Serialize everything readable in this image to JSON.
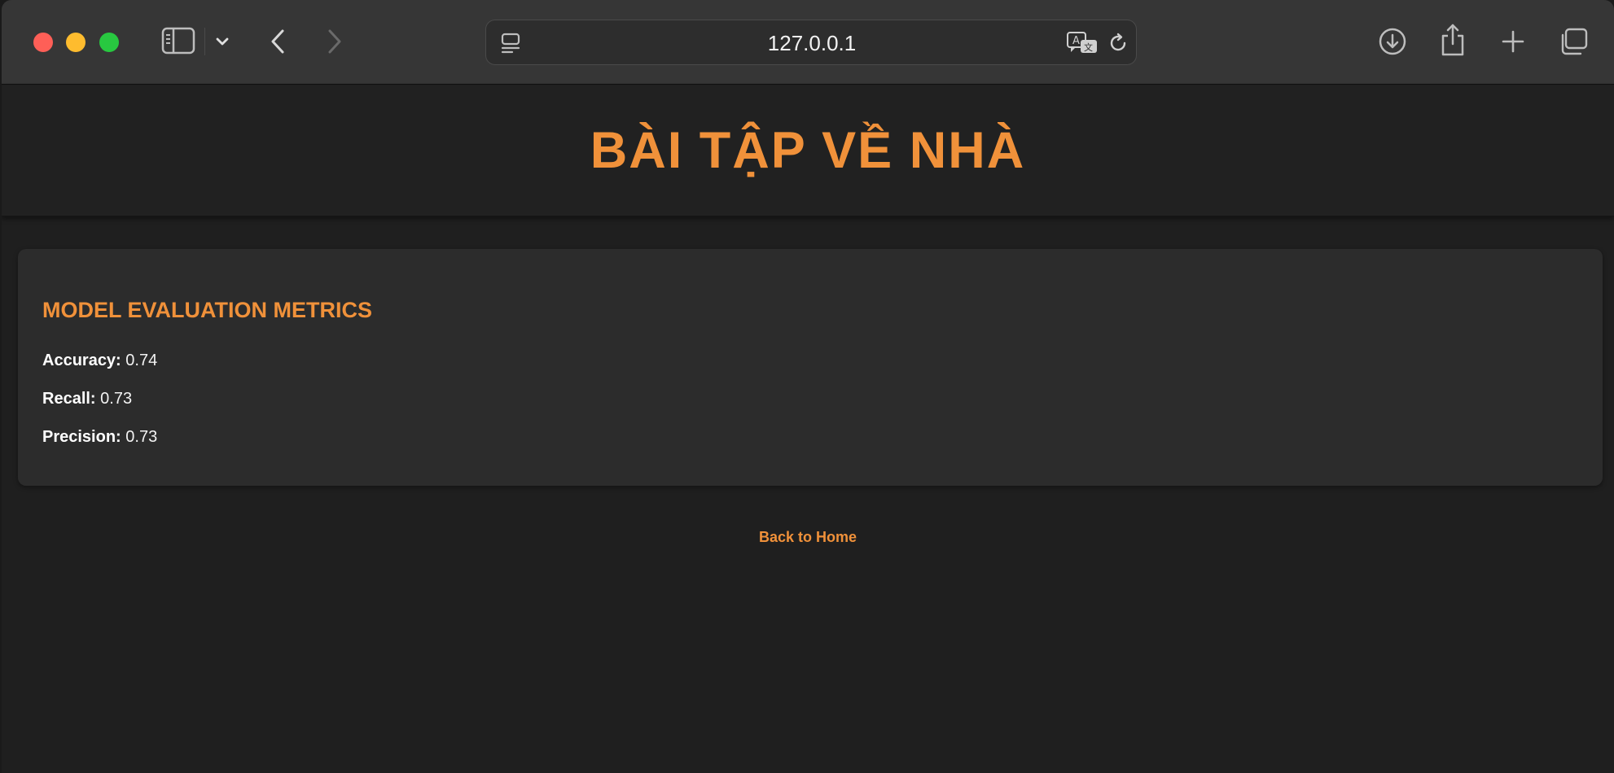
{
  "browser": {
    "url": "127.0.0.1",
    "icons": {
      "sidebar": "sidebar-icon",
      "chevron": "chevron-down-icon",
      "back": "back-arrow-icon",
      "forward": "forward-arrow-icon",
      "reader": "reader-icon",
      "translate": "translate-icon",
      "reload": "reload-icon",
      "download": "download-icon",
      "share": "share-icon",
      "new_tab": "plus-icon",
      "tabs": "tab-overview-icon"
    }
  },
  "page": {
    "title": "BÀI TẬP VỀ NHÀ",
    "metrics_card": {
      "heading": "MODEL EVALUATION METRICS",
      "items": [
        {
          "label": "Accuracy:",
          "value": "0.74"
        },
        {
          "label": "Recall:",
          "value": "0.73"
        },
        {
          "label": "Precision:",
          "value": "0.73"
        }
      ]
    },
    "back_link": "Back to Home"
  },
  "colors": {
    "accent": "#f0913a",
    "background": "#1f1f1f",
    "card": "#2c2c2c",
    "toolbar": "#363636"
  }
}
